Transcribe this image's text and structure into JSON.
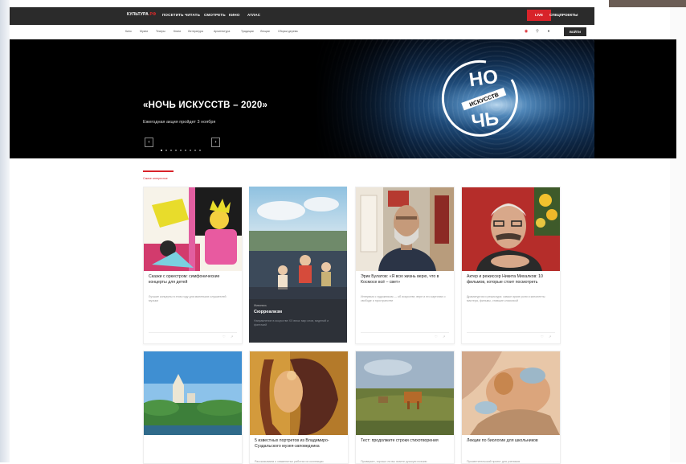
{
  "topnav": {
    "logo_main": "КУЛЬТУРА",
    "logo_accent": ".РФ",
    "items": [
      "ПОСЕТИТЬ",
      "ЧИТАТЬ",
      "СМОТРЕТЬ",
      "КИНО",
      "АТЛАС"
    ],
    "live_label": "LIVE",
    "special_label": "СПЕЦПРОЕКТЫ"
  },
  "subnav": {
    "items": [
      "Кино",
      "Музеи",
      "Театры",
      "Книги",
      "Литература",
      "Архитектура",
      "Традиции",
      "Лекции",
      "Сборки дерева"
    ],
    "login_label": "ВОЙТИ"
  },
  "hero": {
    "title": "«НОЧЬ ИСКУССТВ – 2020»",
    "subtitle": "Ежегодная акция пройдет 3 ноября",
    "slide_count": 9,
    "active_slide": 0,
    "logo_top": "НО",
    "logo_band": "ИСКУССТВ",
    "logo_bottom": "ЧЬ"
  },
  "section": {
    "label": "Самое интересное"
  },
  "cards": [
    {
      "title": "Сказки с оркестром: симфонические концерты для детей",
      "text": "Лучшие концерты в этом году для маленьких слушателей музыки"
    },
    {
      "category": "Живопись",
      "title": "Сюрреализм",
      "text": "Направление в искусстве ХХ века: мир снов, видений и фантазий"
    },
    {
      "title": "Эрик Булатов: «Я всю жизнь верю, что в Космосе всё – свет»",
      "text": "Интервью с художником — об искусстве, вере и его картинах о свободе и пространстве"
    },
    {
      "title": "Актер и режиссер Никита Михалков: 10 фильмов, которые стоит посмотреть",
      "text": "Драматургия и режиссура: самые яркие роли и киноленты мастера, фильмы, ставшие классикой"
    },
    {
      "title": "",
      "text": ""
    },
    {
      "title": "5 известных портретов из Владимиро-Суздальского музея-заповедника",
      "text": "Рассказываем о знаменитых работах из коллекции"
    },
    {
      "title": "Тест: продолжите строки стихотворения",
      "text": "Проверьте, хорошо ли вы знаете русскую поэзию"
    },
    {
      "title": "Лекции по биологии для школьников",
      "text": "Просветительский проект для учеников"
    }
  ]
}
